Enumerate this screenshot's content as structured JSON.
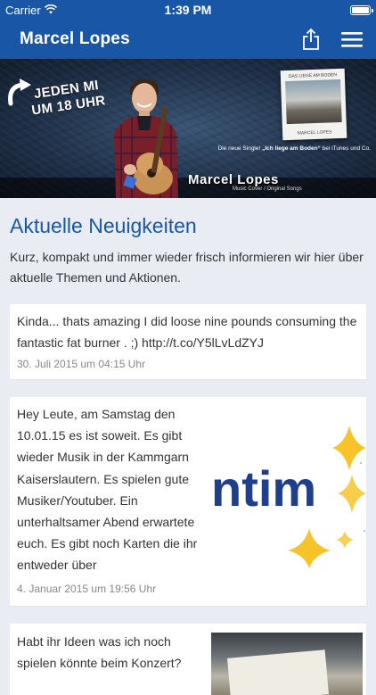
{
  "status_bar": {
    "carrier": "Carrier",
    "time": "1:39 PM",
    "battery_level": 1.0
  },
  "nav": {
    "title": "Marcel Lopes",
    "share_icon": "share-icon",
    "menu_icon": "hamburger-menu-icon"
  },
  "banner": {
    "slogan_line1": "JEDEN MI",
    "slogan_line2": "UM 18 UHR",
    "album_title": "DAS LIEGE AM BODEN",
    "album_sub": "MARCEL LOPES",
    "single_prefix": "Die neue Single! ",
    "single_title": "„Ich liege am Boden“",
    "single_suffix": " bei iTunes und Co.",
    "name": "Marcel Lopes",
    "tagline": "Music Cover / Original Songs"
  },
  "main": {
    "title": "Aktuelle Neuigkeiten",
    "intro": "Kurz, kompakt und immer wieder frisch informieren wir hier über aktuelle Themen und Aktionen.",
    "posts": [
      {
        "text": "Kinda... thats amazing I did loose nine pounds consuming the fantastic fat burner . ;) http://t.co/Y5lLvLdZYJ",
        "date": "30. Juli 2015 um 04:15 Uhr"
      },
      {
        "text": "Hey Leute, am Samstag den 10.01.15 es ist soweit. Es gibt wieder Musik in der Kammgarn Kaiserslautern. Es spielen gute Musiker/Youtuber. Ein unterhaltsamer Abend erwartete euch. Es gibt noch Karten die ihr entweder über",
        "date": "4. Januar 2015 um 19:56 Uhr",
        "image_text": "ntim"
      },
      {
        "text": "Habt ihr Ideen was ich noch spielen könnte beim Konzert?"
      }
    ]
  },
  "colors": {
    "brand_blue": "#1a56a6",
    "background": "#e9edf3",
    "star_yellow": "#f6c42a"
  }
}
